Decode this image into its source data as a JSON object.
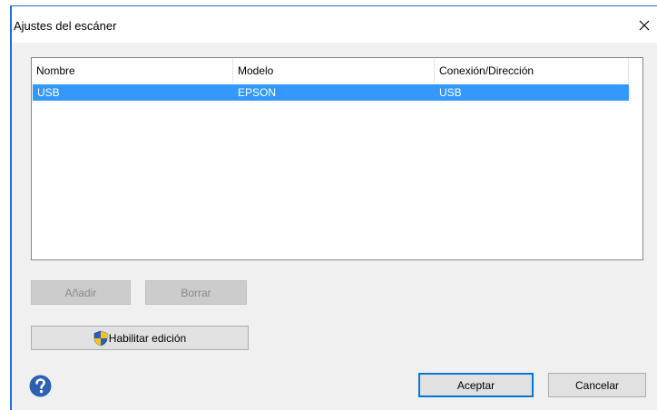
{
  "window": {
    "title": "Ajustes del escáner"
  },
  "table": {
    "columns": [
      "Nombre",
      "Modelo",
      "Conexión/Dirección"
    ],
    "rows": [
      {
        "nombre": "USB",
        "modelo": "EPSON",
        "conexion": "USB",
        "selected": true
      }
    ]
  },
  "buttons": {
    "add": "Añadir",
    "delete": "Borrar",
    "enable_edit": "Habilitar edición",
    "ok": "Aceptar",
    "cancel": "Cancelar"
  },
  "icons": {
    "close": "close-icon",
    "shield": "uac-shield-icon",
    "help": "help-icon"
  },
  "colors": {
    "selection": "#3399ff",
    "help": "#2d5fb3",
    "accent": "#0078d7"
  }
}
